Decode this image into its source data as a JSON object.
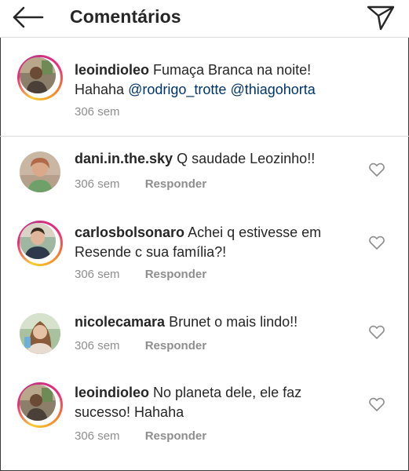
{
  "header": {
    "title": "Comentários"
  },
  "caption": {
    "username": "leoindioleo",
    "text": "Fumaça Branca na noite! Hahaha",
    "mention_1": "@rodrigo_trotte",
    "mention_2": "@thiagohorta",
    "time": "306 sem"
  },
  "comments": [
    {
      "username": "dani.in.the.sky",
      "text": "Q saudade Leozinho!!",
      "time": "306 sem",
      "reply_label": "Responder"
    },
    {
      "username": "carlosbolsonaro",
      "text": "Achei q estivesse em Resende c sua família?!",
      "time": "306 sem",
      "reply_label": "Responder"
    },
    {
      "username": "nicolecamara",
      "text": "Brunet o mais lindo!!",
      "time": "306 sem",
      "reply_label": "Responder"
    },
    {
      "username": "leoindioleo",
      "text": "No planeta dele, ele faz sucesso! Hahaha",
      "time": "306 sem",
      "reply_label": "Responder"
    }
  ],
  "icons": {
    "back": "arrow-left-icon",
    "send": "paper-plane-icon",
    "like": "heart-outline-icon"
  },
  "colors": {
    "text": "#262626",
    "muted": "#8e8e8e",
    "mention": "#003569",
    "divider": "#dbdbdb",
    "story_ring_start": "#f9ce34",
    "story_ring_mid": "#ee2a7b",
    "story_ring_end": "#c13584"
  }
}
